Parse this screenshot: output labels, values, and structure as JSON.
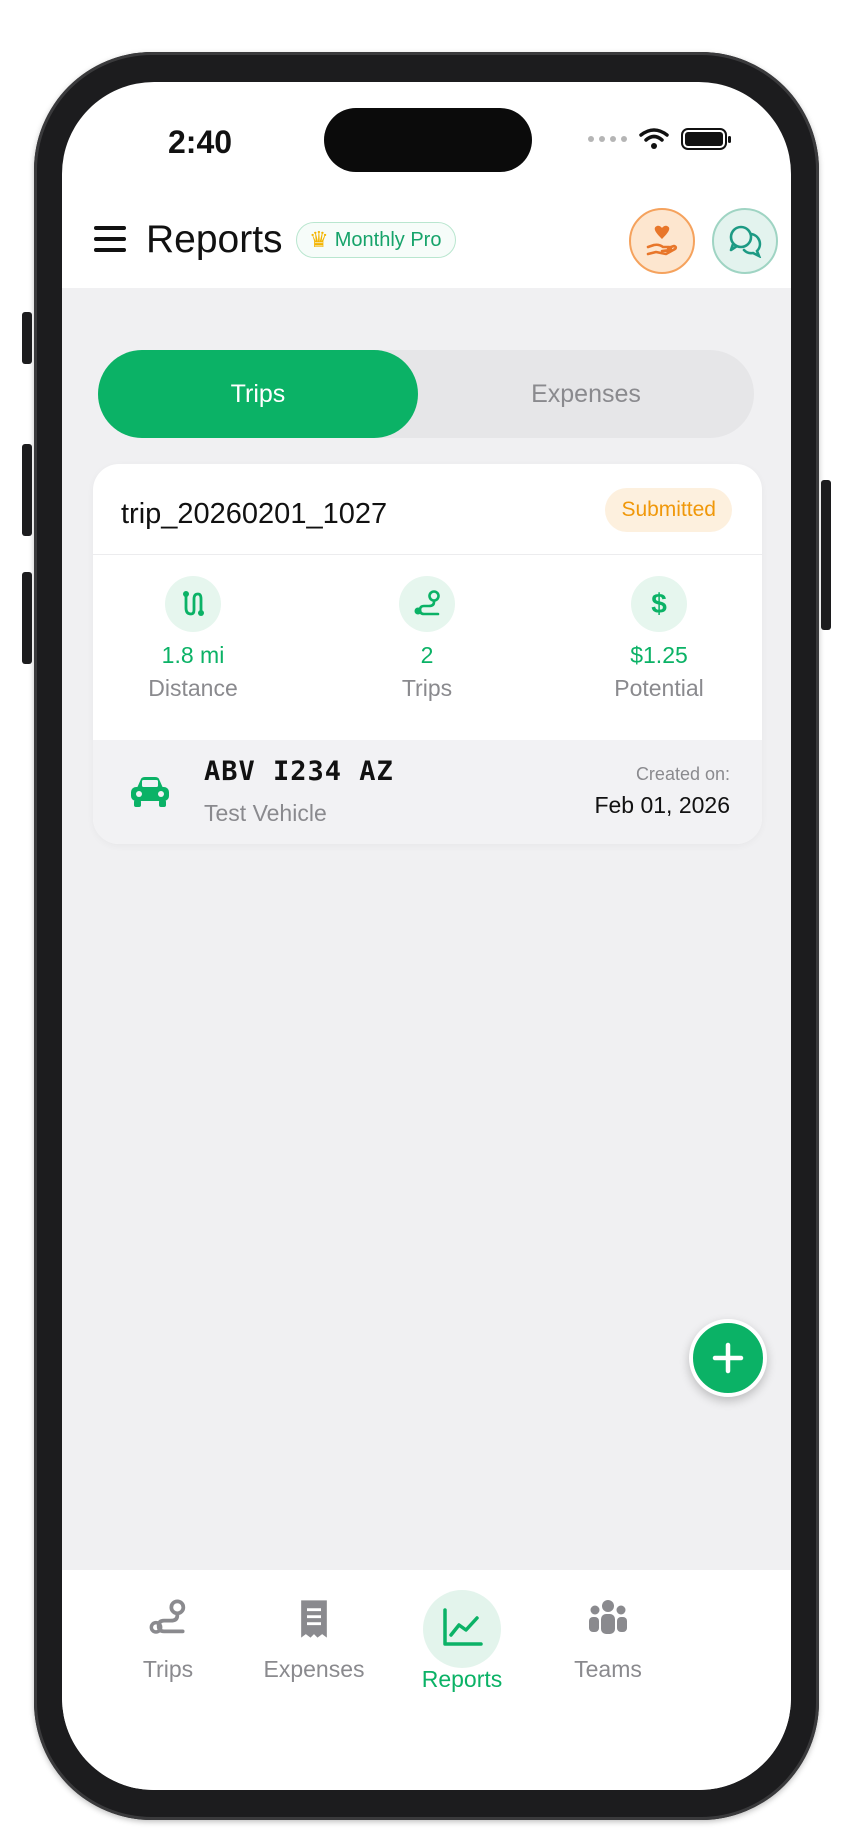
{
  "status_bar": {
    "time": "2:40"
  },
  "header": {
    "title": "Reports",
    "plan_badge": "Monthly Pro"
  },
  "segmented": {
    "tabs": [
      "Trips",
      "Expenses"
    ],
    "active": "Trips"
  },
  "report": {
    "id": "trip_20260201_1027",
    "status": "Submitted",
    "stats": [
      {
        "value": "1.8 mi",
        "label": "Distance",
        "icon": "distance-icon"
      },
      {
        "value": "2",
        "label": "Trips",
        "icon": "route-icon"
      },
      {
        "value": "$1.25",
        "label": "Potential",
        "icon": "dollar-icon"
      }
    ],
    "vehicle": {
      "plate": "ABV I234 AZ",
      "name": "Test Vehicle",
      "created_label": "Created on:",
      "created_date": "Feb 01, 2026"
    }
  },
  "bottom_nav": {
    "items": [
      {
        "label": "Trips",
        "icon": "route-icon"
      },
      {
        "label": "Expenses",
        "icon": "receipt-icon"
      },
      {
        "label": "Reports",
        "icon": "chart-line-icon"
      },
      {
        "label": "Teams",
        "icon": "team-icon"
      }
    ],
    "active": "Reports"
  },
  "colors": {
    "accent": "#0bb266",
    "badge_orange": "#f0980a",
    "background": "#f0f0f2"
  }
}
